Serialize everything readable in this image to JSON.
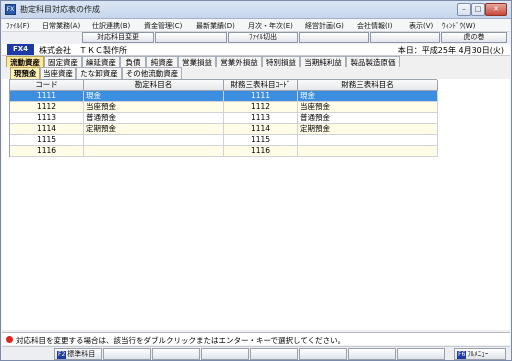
{
  "window": {
    "title": "勘定科目対応表の作成",
    "app_icon_text": "FX"
  },
  "menu": [
    "ﾌｧｲﾙ(F)",
    "日常業務(A)",
    "仕訳連携(B)",
    "資金管理(C)",
    "最新業績(D)",
    "月次・年次(E)",
    "経営計画(G)",
    "会社情報(I)",
    "表示(V)",
    "ｳｨﾝﾄﾞｳ(W)"
  ],
  "toolbar": {
    "change_button": "対応科目変更",
    "file_switch_button": "ﾌｧｲﾙ切出",
    "help_button": "虎の巻"
  },
  "company": {
    "badge": "FX4",
    "name": "株式会社　ＴＫＣ製作所",
    "today": "本日：平成25年 4月30日(火)"
  },
  "tabs_main": [
    "流動資産",
    "固定資産",
    "繰延資産",
    "負債",
    "純資産",
    "営業損益",
    "営業外損益",
    "特別損益",
    "当期純利益",
    "製品製造原価"
  ],
  "tabs_sub": [
    "現預金",
    "当座資産",
    "たな卸資産",
    "その他流動資産"
  ],
  "table": {
    "headers": [
      "コード",
      "勘定科目名",
      "財務三表科目ｺｰﾄﾞ",
      "財務三表科目名"
    ],
    "rows": [
      {
        "code": "1111",
        "name": "現金",
        "fs_code": "1111",
        "fs_name": "現金"
      },
      {
        "code": "1112",
        "name": "当座預金",
        "fs_code": "1112",
        "fs_name": "当座預金"
      },
      {
        "code": "1113",
        "name": "普通預金",
        "fs_code": "1113",
        "fs_name": "普通預金"
      },
      {
        "code": "1114",
        "name": "定期預金",
        "fs_code": "1114",
        "fs_name": "定期預金"
      },
      {
        "code": "1115",
        "name": "",
        "fs_code": "1115",
        "fs_name": ""
      },
      {
        "code": "1116",
        "name": "",
        "fs_code": "1116",
        "fs_name": ""
      }
    ]
  },
  "status": {
    "message": "対応科目を変更する場合は、該当行をダブルクリックまたはエンター・キーで選択してください。"
  },
  "fkeys": {
    "f2_badge": "F2",
    "f2_label": "標準科目",
    "f6_badge": "F6",
    "f6_label": "ﾌﾙﾒﾆｭｰ"
  },
  "colors": {
    "selected_row": "#3c8fe0",
    "active_tab": "#ffe89a",
    "badge_blue": "#1e3aa8",
    "status_dot": "#e0251c"
  }
}
